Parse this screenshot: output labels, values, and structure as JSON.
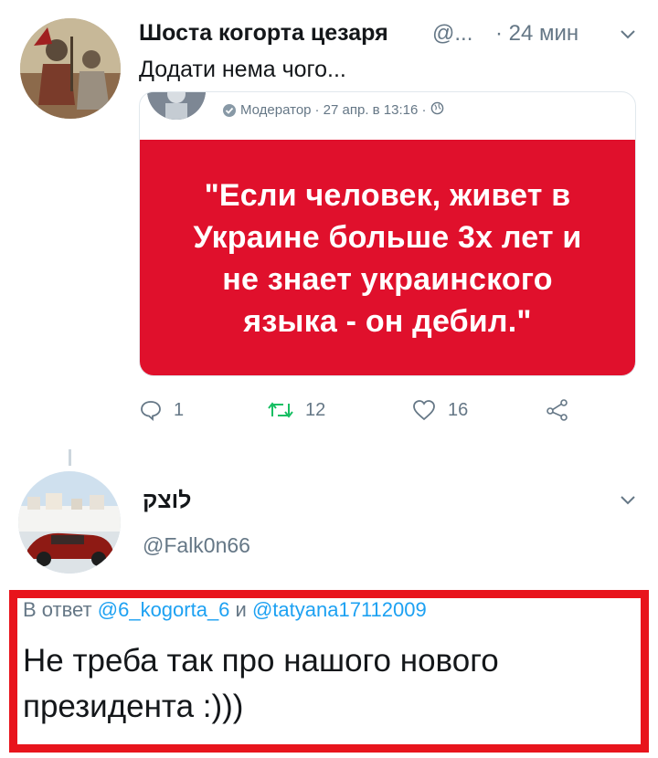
{
  "tweet1": {
    "author_name": "Шоста когорта цезаря",
    "handle": "@...",
    "time": "· 24 мин",
    "text": "Додати нема чого...",
    "quote": {
      "author": "Модератор",
      "timestamp": "· 27 апр. в 13:16 ·",
      "card_text": "\"Если человек, живет в Украине больше 3х лет и не знает украинского языка - он дебил.\""
    },
    "actions": {
      "replies": "1",
      "retweets": "12",
      "likes": "16"
    }
  },
  "tweet2": {
    "author_name": "לוצק",
    "handle": "@Falk0n66",
    "reply_prefix": "В ответ",
    "reply_mention1": "@6_kogorta_6",
    "reply_conj": "и",
    "reply_mention2": "@tatyana17112009",
    "text": "Не треба так про нашого нового президента :)))"
  },
  "colors": {
    "card_red": "#e0102c",
    "highlight_border": "#e8141c",
    "retweet_green": "#17bf63",
    "mention_blue": "#1da1f2",
    "secondary_text": "#657786"
  },
  "icons": [
    "chevron-down-icon",
    "reply-icon",
    "retweet-icon",
    "like-icon",
    "share-icon",
    "verified-badge-icon",
    "globe-icon"
  ]
}
